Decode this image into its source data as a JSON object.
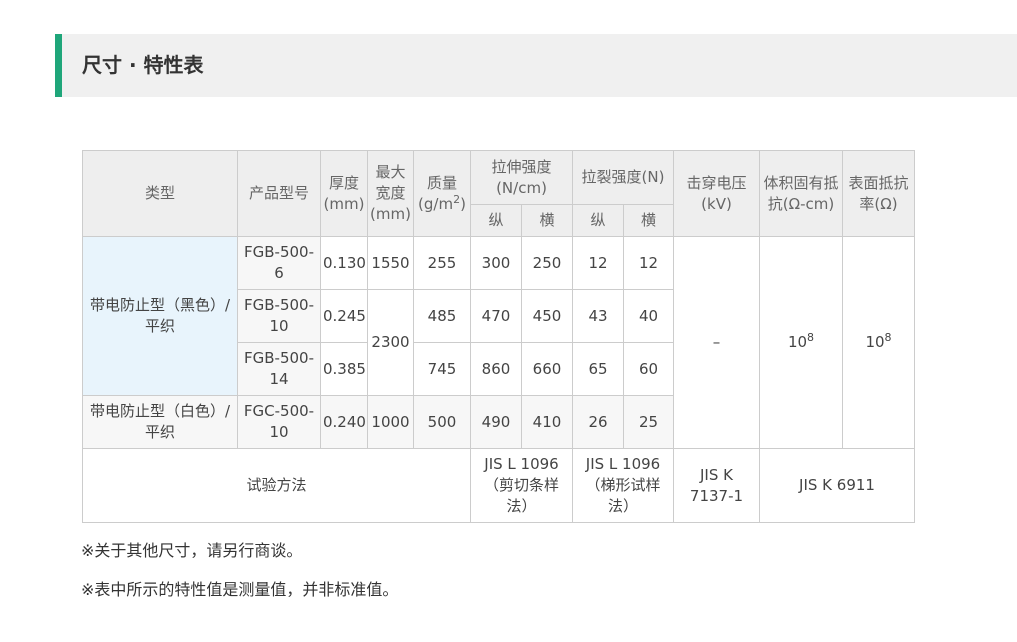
{
  "section": {
    "title": "尺寸 · 特性表"
  },
  "table": {
    "headers": {
      "type": "类型",
      "model": "产品型号",
      "thickness": "厚度(mm)",
      "max_width": "最大宽度(mm)",
      "mass": "质量(g/m",
      "mass_exp": "2",
      "mass_close": ")",
      "tensile": "拉伸强度(N/cm)",
      "tear": "拉裂强度(N)",
      "breakdown": "击穿电压(kV)",
      "volume_resistivity": "体积固有抵抗(Ω-cm)",
      "surface_resistivity": "表面抵抗率(Ω)",
      "longitudinal": "纵",
      "transverse": "横"
    },
    "groups": [
      {
        "type": "带电防止型（黑色）/ 平织"
      },
      {
        "type": "带电防止型（白色）/ 平织"
      }
    ],
    "rows": [
      {
        "model": "FGB-500-6",
        "thickness": "0.130",
        "width": "1550",
        "mass": "255",
        "tensile_l": "300",
        "tensile_t": "250",
        "tear_l": "12",
        "tear_t": "12"
      },
      {
        "model": "FGB-500-10",
        "thickness": "0.245",
        "width": "2300",
        "mass": "485",
        "tensile_l": "470",
        "tensile_t": "450",
        "tear_l": "43",
        "tear_t": "40"
      },
      {
        "model": "FGB-500-14",
        "thickness": "0.385",
        "mass": "745",
        "tensile_l": "860",
        "tensile_t": "660",
        "tear_l": "65",
        "tear_t": "60"
      },
      {
        "model": "FGC-500-10",
        "thickness": "0.240",
        "width": "1000",
        "mass": "500",
        "tensile_l": "490",
        "tensile_t": "410",
        "tear_l": "26",
        "tear_t": "25"
      }
    ],
    "shared": {
      "breakdown": "–",
      "volume_base": "10",
      "volume_exp": "8",
      "surface_base": "10",
      "surface_exp": "8"
    },
    "test_methods": {
      "label": "试验方法",
      "tensile": "JIS L 1096（剪切条样法）",
      "tear": "JIS L 1096（梯形试样法）",
      "breakdown": "JIS K 7137-1",
      "resistivity": "JIS K 6911"
    }
  },
  "notes": [
    "※关于其他尺寸，请另行商谈。",
    "※表中所示的特性值是测量值，并非标准值。"
  ]
}
